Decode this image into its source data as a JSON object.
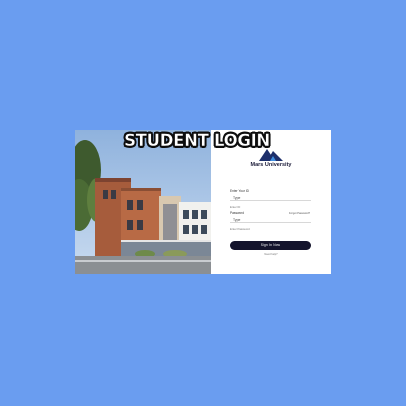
{
  "page": {
    "headline": "STUDENT LOGIN"
  },
  "brand": {
    "name": "Mars University",
    "logo_icon": "mountain-logo-icon",
    "colors": {
      "background": "#6a9df0",
      "logo_primary": "#1d2f6b",
      "logo_secondary": "#3f8ee0",
      "button": "#14142c"
    }
  },
  "form": {
    "id_label": "Enter Your ID",
    "id_field_value": "Type",
    "id_sublabel": "Enter ID",
    "password_label": "Password",
    "forgot_link": "Forgot Password?",
    "password_field_value": "Type",
    "password_sublabel": "Enter Password",
    "submit_label": "Sign In Now",
    "help_text": "Need help?"
  }
}
